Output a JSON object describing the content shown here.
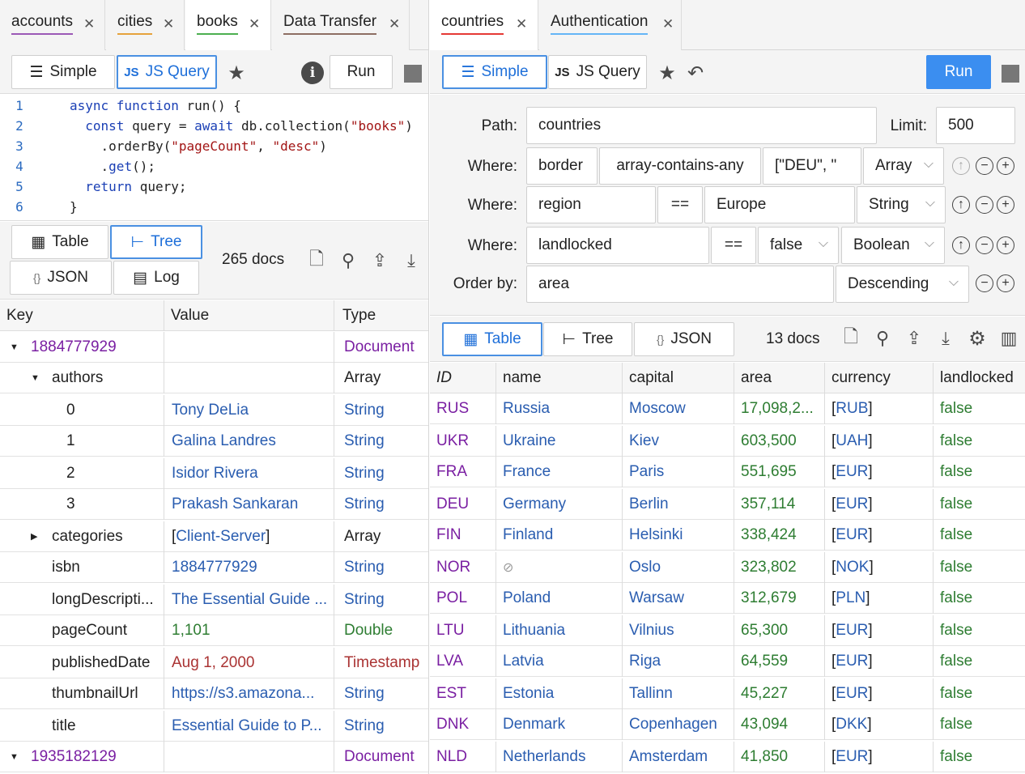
{
  "left": {
    "tabs": [
      {
        "label": "accounts",
        "color": "#9b59b6"
      },
      {
        "label": "cities",
        "color": "#e6a23c"
      },
      {
        "label": "books",
        "color": "#4caf50"
      },
      {
        "label": "Data Transfer",
        "color": "#8d6e63"
      }
    ],
    "toolbar": {
      "simple": "Simple",
      "jsquery": "JS Query",
      "run": "Run"
    },
    "code": [
      {
        "n": "1",
        "html": "<span class='kw'>async function</span> run() {"
      },
      {
        "n": "2",
        "html": "  <span class='kw'>const</span> query = <span class='kw'>await</span> db.collection(<span class='st'>\"books\"</span>)"
      },
      {
        "n": "3",
        "html": "    .orderBy(<span class='st'>\"pageCount\"</span>, <span class='st'>\"desc\"</span>)"
      },
      {
        "n": "4",
        "html": "    .<span class='fn'>get</span>();"
      },
      {
        "n": "5",
        "html": "  <span class='kw'>return</span> query;"
      },
      {
        "n": "6",
        "html": "}"
      }
    ],
    "views": {
      "table": "Table",
      "tree": "Tree",
      "json": "JSON",
      "log": "Log",
      "count": "265 docs"
    },
    "columns": [
      "Key",
      "Value",
      "Type"
    ],
    "rows": [
      {
        "indent": 0,
        "toggle": "down",
        "key": "1884777929",
        "keyClass": "purple",
        "value": "",
        "type": "Document",
        "typeClass": "purple"
      },
      {
        "indent": 1,
        "toggle": "down",
        "key": "authors",
        "keyClass": "",
        "value": "",
        "type": "Array",
        "typeClass": ""
      },
      {
        "indent": 2,
        "toggle": "",
        "key": "0",
        "keyClass": "",
        "value": "Tony DeLia",
        "valClass": "blue2",
        "type": "String",
        "typeClass": "blue2"
      },
      {
        "indent": 2,
        "toggle": "",
        "key": "1",
        "keyClass": "",
        "value": "Galina Landres",
        "valClass": "blue2",
        "type": "String",
        "typeClass": "blue2"
      },
      {
        "indent": 2,
        "toggle": "",
        "key": "2",
        "keyClass": "",
        "value": "Isidor Rivera",
        "valClass": "blue2",
        "type": "String",
        "typeClass": "blue2"
      },
      {
        "indent": 2,
        "toggle": "",
        "key": "3",
        "keyClass": "",
        "value": "Prakash Sankaran",
        "valClass": "blue2",
        "type": "String",
        "typeClass": "blue2"
      },
      {
        "indent": 1,
        "toggle": "right",
        "key": "categories",
        "keyClass": "",
        "value": "[Client-Server]",
        "valClass": "blue2",
        "type": "Array",
        "typeClass": ""
      },
      {
        "indent": 1,
        "toggle": "",
        "key": "isbn",
        "keyClass": "",
        "value": "1884777929",
        "valClass": "blue2",
        "type": "String",
        "typeClass": "blue2"
      },
      {
        "indent": 1,
        "toggle": "",
        "key": "longDescripti...",
        "keyClass": "",
        "value": "The Essential Guide ...",
        "valClass": "blue2",
        "type": "String",
        "typeClass": "blue2"
      },
      {
        "indent": 1,
        "toggle": "",
        "key": "pageCount",
        "keyClass": "",
        "value": "1,101",
        "valClass": "green",
        "type": "Double",
        "typeClass": "green"
      },
      {
        "indent": 1,
        "toggle": "",
        "key": "publishedDate",
        "keyClass": "",
        "value": "Aug 1, 2000",
        "valClass": "brown",
        "type": "Timestamp",
        "typeClass": "brown"
      },
      {
        "indent": 1,
        "toggle": "",
        "key": "thumbnailUrl",
        "keyClass": "",
        "value": "https://s3.amazona...",
        "valClass": "blue2",
        "type": "String",
        "typeClass": "blue2"
      },
      {
        "indent": 1,
        "toggle": "",
        "key": "title",
        "keyClass": "",
        "value": "Essential Guide to P...",
        "valClass": "blue2",
        "type": "String",
        "typeClass": "blue2"
      },
      {
        "indent": 0,
        "toggle": "down",
        "key": "1935182129",
        "keyClass": "purple",
        "value": "",
        "type": "Document",
        "typeClass": "purple"
      }
    ]
  },
  "right": {
    "tabs": [
      {
        "label": "countries",
        "color": "#e53935"
      },
      {
        "label": "Authentication",
        "color": "#64b5f6"
      }
    ],
    "toolbar": {
      "simple": "Simple",
      "jsquery": "JS Query",
      "run": "Run"
    },
    "path": {
      "label": "Path:",
      "value": "countries",
      "limit_label": "Limit:",
      "limit": "500"
    },
    "where": [
      {
        "label": "Where:",
        "field": "border",
        "op": "array-contains-any",
        "value": "[\"DEU\", \"",
        "type": "Array"
      },
      {
        "label": "Where:",
        "field": "region",
        "op": "==",
        "value": "Europe",
        "type": "String"
      },
      {
        "label": "Where:",
        "field": "landlocked",
        "op": "==",
        "value": "false",
        "type": "Boolean"
      }
    ],
    "orderby": {
      "label": "Order by:",
      "field": "area",
      "dir": "Descending"
    },
    "views": {
      "table": "Table",
      "tree": "Tree",
      "json": "JSON",
      "count": "13 docs"
    },
    "columns": [
      "ID",
      "name",
      "capital",
      "area",
      "currency",
      "landlocked"
    ],
    "rows": [
      [
        "RUS",
        "Russia",
        "Moscow",
        "17,098,2...",
        "RUB",
        "false"
      ],
      [
        "UKR",
        "Ukraine",
        "Kiev",
        "603,500",
        "UAH",
        "false"
      ],
      [
        "FRA",
        "France",
        "Paris",
        "551,695",
        "EUR",
        "false"
      ],
      [
        "DEU",
        "Germany",
        "Berlin",
        "357,114",
        "EUR",
        "false"
      ],
      [
        "FIN",
        "Finland",
        "Helsinki",
        "338,424",
        "EUR",
        "false"
      ],
      [
        "NOR",
        "",
        "Oslo",
        "323,802",
        "NOK",
        "false"
      ],
      [
        "POL",
        "Poland",
        "Warsaw",
        "312,679",
        "PLN",
        "false"
      ],
      [
        "LTU",
        "Lithuania",
        "Vilnius",
        "65,300",
        "EUR",
        "false"
      ],
      [
        "LVA",
        "Latvia",
        "Riga",
        "64,559",
        "EUR",
        "false"
      ],
      [
        "EST",
        "Estonia",
        "Tallinn",
        "45,227",
        "EUR",
        "false"
      ],
      [
        "DNK",
        "Denmark",
        "Copenhagen",
        "43,094",
        "DKK",
        "false"
      ],
      [
        "NLD",
        "Netherlands",
        "Amsterdam",
        "41,850",
        "EUR",
        "false"
      ]
    ]
  }
}
